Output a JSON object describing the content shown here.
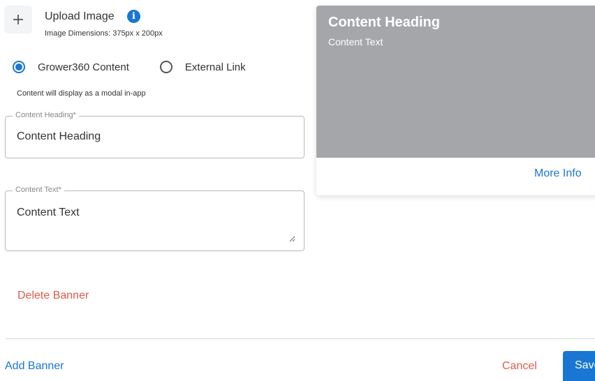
{
  "upload": {
    "title": "Upload Image",
    "info_icon": "info-icon",
    "dimensions": "Image Dimensions: 375px x 200px",
    "add_icon": "plus-icon"
  },
  "content_type": {
    "options": [
      {
        "label": "Grower360 Content",
        "checked": true
      },
      {
        "label": "External Link",
        "checked": false
      }
    ],
    "helper": "Content will display as a modal in-app"
  },
  "fields": {
    "heading": {
      "label": "Content Heading*",
      "value": "Content Heading"
    },
    "text": {
      "label": "Content Text*",
      "value": "Content Text"
    }
  },
  "actions": {
    "delete": "Delete Banner",
    "add": "Add Banner",
    "cancel": "Cancel",
    "save": "Save"
  },
  "preview": {
    "heading": "Content Heading",
    "text": "Content Text",
    "more_info": "More Info",
    "image_color": "#a4a6a9"
  },
  "colors": {
    "primary": "#1976d2",
    "danger": "#e05a4e"
  }
}
